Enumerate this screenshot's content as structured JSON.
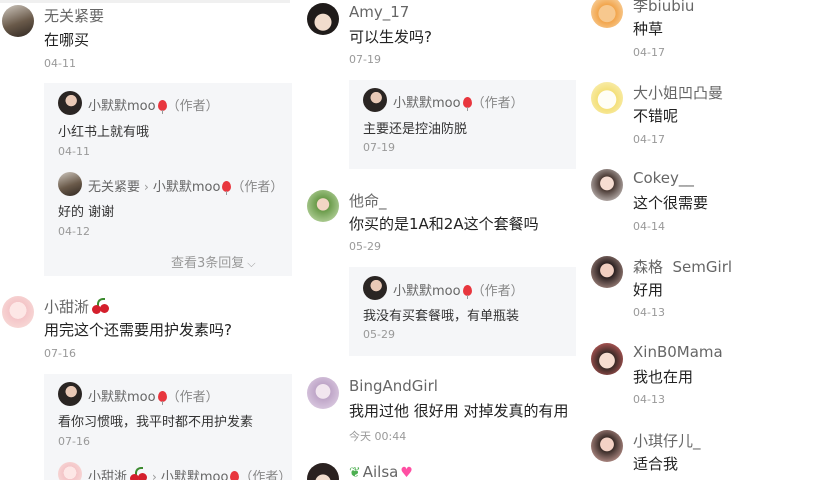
{
  "col1": {
    "c1": {
      "name": "无关紧要",
      "content": "在哪买",
      "date": "04-11"
    },
    "c1_replies": [
      {
        "name": "小默默moo",
        "author": "（作者）",
        "content": "小红书上就有哦",
        "date": "04-11"
      },
      {
        "from": "无关紧要",
        "to": "小默默moo",
        "author": "（作者）",
        "content": "好的 谢谢",
        "date": "04-12"
      }
    ],
    "c1_more": "查看3条回复",
    "c2": {
      "name": "小甜淅",
      "content": "用完这个还需要用护发素吗?",
      "date": "07-16"
    },
    "c2_replies": [
      {
        "name": "小默默moo",
        "author": "（作者）",
        "content": "看你习惯哦，我平时都不用护发素",
        "date": "07-16"
      },
      {
        "from": "小甜淅",
        "to": "小默默moo",
        "author": "（作者）"
      }
    ]
  },
  "col2": {
    "c1": {
      "name": "Amy_17",
      "content": "可以生发吗?",
      "date": "07-19"
    },
    "c1_reply": {
      "name": "小默默moo",
      "author": "（作者）",
      "content": "主要还是控油防脱",
      "date": "07-19"
    },
    "c2": {
      "name": "他命_",
      "content": "你买的是1A和2A这个套餐吗",
      "date": "05-29"
    },
    "c2_reply": {
      "name": "小默默moo",
      "author": "（作者）",
      "content": "我没有买套餐哦，有单瓶装",
      "date": "05-29"
    },
    "c3": {
      "name": "BingAndGirl",
      "content": "我用过他 很好用 对掉发真的有用",
      "date": "今天 00:44"
    },
    "c4": {
      "name": "Ailsa"
    }
  },
  "col3": [
    {
      "name": "李biubiu",
      "content": "种草",
      "date": "04-17"
    },
    {
      "name": "大小姐凹凸曼",
      "content": "不错呢",
      "date": "04-17"
    },
    {
      "name": "Cokey__",
      "content": "这个很需要",
      "date": "04-14"
    },
    {
      "name": "森格  SemGirl",
      "content": "好用",
      "date": "04-13"
    },
    {
      "name": "XinB0Mama",
      "content": "我也在用",
      "date": "04-13"
    },
    {
      "name": "小琪仔儿_",
      "content": "适合我"
    }
  ],
  "colors": {
    "bg": "#ffffff",
    "reply_bg": "#f5f6f8",
    "balloon": "#e8363e",
    "meta": "#999999"
  },
  "icons": [
    "avatar",
    "balloon-emoji",
    "cherry-emoji",
    "heart-emoji",
    "leaf-emoji",
    "chevron-right-icon",
    "chevron-down-icon"
  ]
}
